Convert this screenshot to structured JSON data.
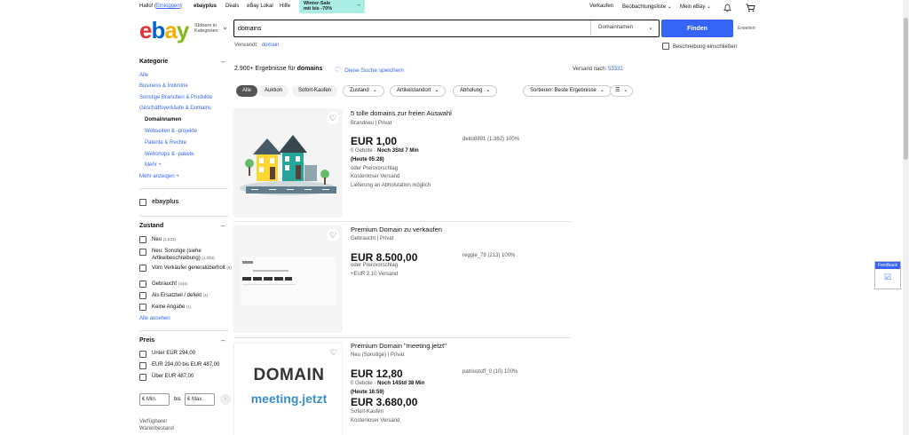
{
  "topbar": {
    "greeting_pre": "Hallo!",
    "login": "Einloggen",
    "ebay_plus": "ebayplus",
    "deals": "Deals",
    "ebay_local": "eBay Lokal",
    "help": "Hilfe",
    "sale_line1": "Winter-Sale",
    "sale_line2": "mit bis -70%",
    "sell": "Verkaufen",
    "watchlist": "Beobachtungsliste",
    "my_ebay": "Mein eBay"
  },
  "header": {
    "logo": {
      "e": "e",
      "b": "b",
      "a": "a",
      "y": "y"
    },
    "browse_line1": "Stöbern in",
    "browse_line2": "Kategorien",
    "search_value": "domains",
    "search_category": "Domainnamen",
    "find_label": "Finden",
    "advanced": "Erweitert",
    "related_label": "Verwandt:",
    "related_link": "domain",
    "desc_include": "Beschreibung einschließen"
  },
  "sidebar": {
    "category_heading": "Kategorie",
    "categories": [
      {
        "label": "Alle"
      },
      {
        "label": "Business & Industrie"
      },
      {
        "label": "Sonstige Branchen & Produkte"
      },
      {
        "label": "Geschäftsverkäufe & Domains"
      },
      {
        "label": "Domainnamen"
      },
      {
        "label": "Webseiten & -projekte"
      },
      {
        "label": "Patente & Rechte"
      },
      {
        "label": "Webshops & -pakete"
      },
      {
        "label": "Mehr +"
      },
      {
        "label": "Mehr anzeigen +"
      }
    ],
    "ebayplus_label": "ebayplus",
    "condition_heading": "Zustand",
    "conditions": [
      {
        "label": "Neu",
        "count": "(1.523)"
      },
      {
        "label": "Neu: Sonstige (siehe Artikelbeschreibung)",
        "count": "(1.040)"
      },
      {
        "label": "Vom Verkäufer generalüberholt",
        "count": "(9)"
      },
      {
        "label": "Gebraucht",
        "count": "(444)"
      },
      {
        "label": "Als Ersatzteil / defekt",
        "count": "(1)"
      },
      {
        "label": "Keine Angabe",
        "count": "(1)"
      }
    ],
    "see_all": "Alle ansehen",
    "price_heading": "Preis",
    "prices": [
      {
        "label": "Unter EUR 294,00"
      },
      {
        "label": "EUR 294,00 bis EUR 487,00"
      },
      {
        "label": "Über EUR 487,00"
      }
    ],
    "min_placeholder": "Min.",
    "max_placeholder": "Max.",
    "currency": "€",
    "to": "bis",
    "go": "›",
    "availability_line1": "Verfügbarer",
    "availability_line2": "Warenbestand"
  },
  "results": {
    "count": "2.900+ Ergebnisse für",
    "query": "domains",
    "save_search": "Diese Suche speichern",
    "ship_to_label": "Versand nach:",
    "ship_to_zip": "53332",
    "chips": [
      {
        "label": "Alle"
      },
      {
        "label": "Auktion"
      },
      {
        "label": "Sofort-Kaufen"
      },
      {
        "label": "Zustand"
      },
      {
        "label": "Artikelstandort"
      },
      {
        "label": "Abholung"
      },
      {
        "label": "Sortieren: Beste Ergebnisse"
      }
    ],
    "items": [
      {
        "title": "5 tolle domains zur freien Auswahl",
        "condition": "Brandneu | Privat",
        "price": "EUR 1,00",
        "bids_pre": "0 Gebote · ",
        "bids_time": "Noch 3Std 7 Min",
        "end": "(Heute 05:28)",
        "offer": "oder Preisvorschlag",
        "shipping": "Kostenloser Versand",
        "pickup": "Lieferung an Abholstation möglich",
        "seller": "deito8891 (1.362) 100%"
      },
      {
        "title": "Premium Domain zu verkaufen",
        "condition": "Gebraucht | Privat",
        "price": "EUR 8.500,00",
        "offer": "oder Preisvorschlag",
        "shipping": "+EUR 2,10 Versand",
        "seller": "reggie_79 (213) 100%"
      },
      {
        "title": "Premium Domain \"meeting.jetzt\"",
        "condition": "Neu (Sonstige) | Privat",
        "price": "EUR 12,80",
        "bids_pre": "0 Gebote · ",
        "bids_time": "Noch 14Std 38 Min",
        "end": "(Heute 16:59)",
        "price2": "EUR 3.680,00",
        "buy_now": "Sofort-Kaufen",
        "shipping": "Kostenloser Versand",
        "seller": "patriostoff_0 (10) 100%",
        "img_word1": "DOMAIN",
        "img_word2": "meeting.jetzt"
      }
    ]
  },
  "feedback_label": "Feedback",
  "colors": {
    "accent": "#3665f3",
    "logo_red": "#e53238",
    "logo_blue": "#0064d2",
    "logo_yellow": "#f5af02",
    "logo_green": "#86b817"
  }
}
